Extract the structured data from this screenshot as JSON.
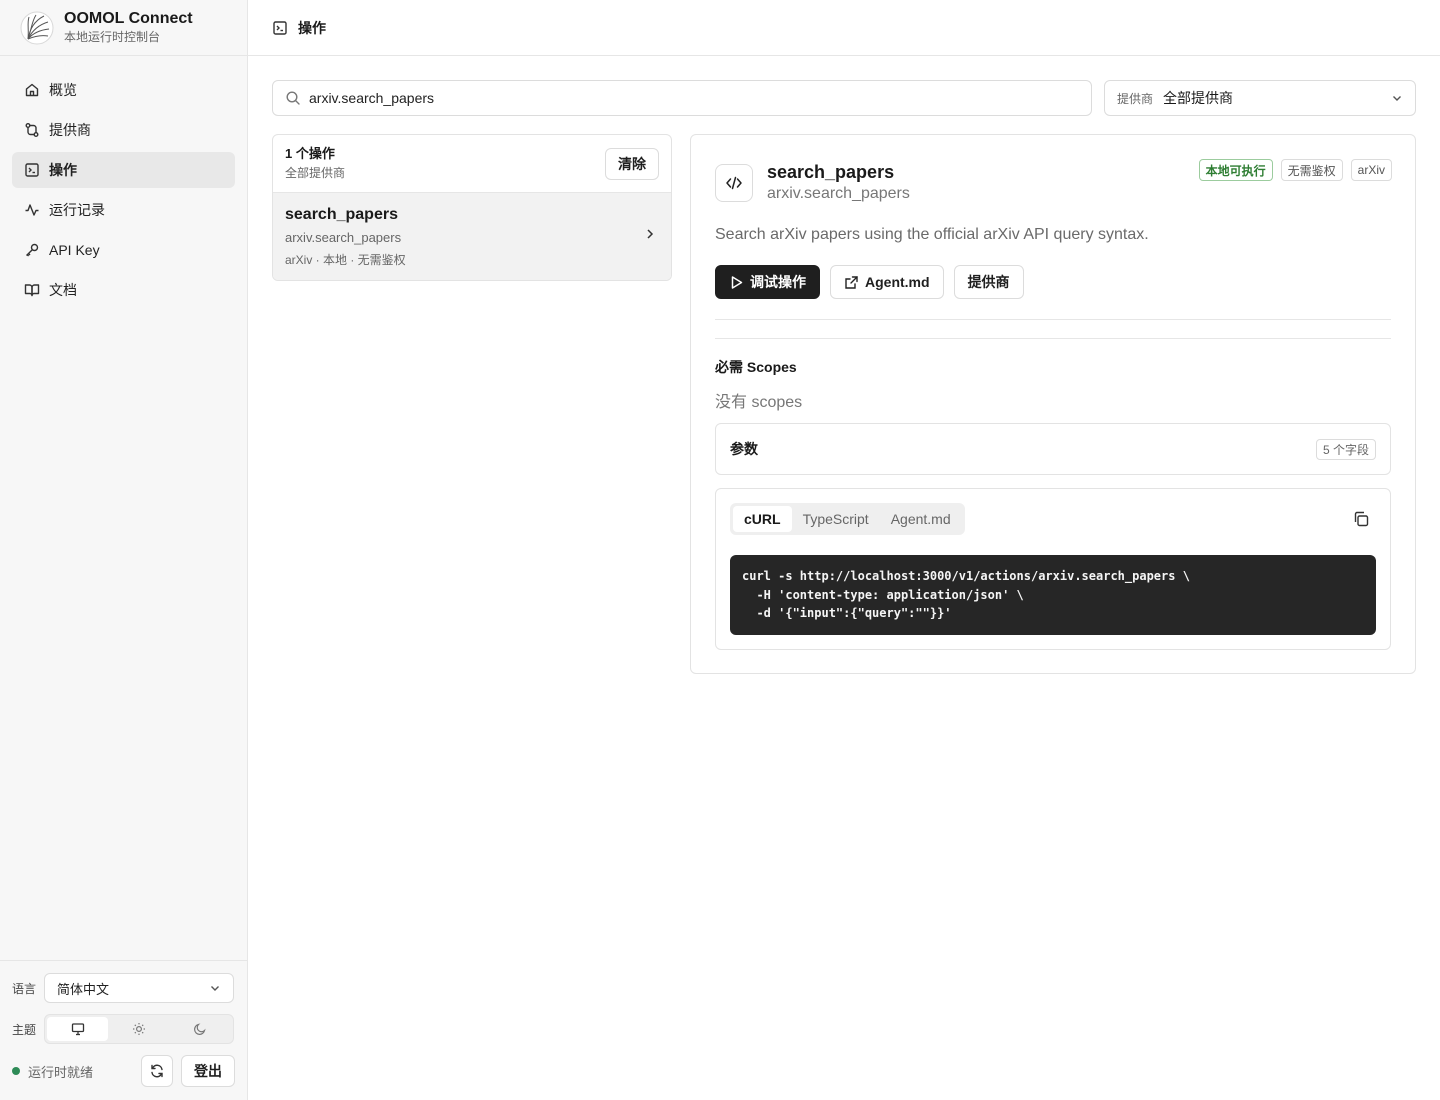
{
  "app": {
    "name": "OOMOL Connect",
    "subtitle": "本地运行时控制台"
  },
  "sidebar": {
    "items": [
      {
        "label": "概览",
        "icon": "home-icon",
        "active": false
      },
      {
        "label": "提供商",
        "icon": "route-icon",
        "active": false
      },
      {
        "label": "操作",
        "icon": "terminal-icon",
        "active": true
      },
      {
        "label": "运行记录",
        "icon": "activity-icon",
        "active": false
      },
      {
        "label": "API Key",
        "icon": "key-icon",
        "active": false
      },
      {
        "label": "文档",
        "icon": "book-icon",
        "active": false
      }
    ],
    "language_label": "语言",
    "language_value": "简体中文",
    "theme_label": "主题",
    "theme_options": [
      "system",
      "light",
      "dark"
    ],
    "theme_selected": "system",
    "status_text": "运行时就绪",
    "status_color": "#2e8b57",
    "logout_label": "登出"
  },
  "header": {
    "title": "操作"
  },
  "filters": {
    "search_value": "arxiv.search_papers",
    "provider_label": "提供商",
    "provider_value": "全部提供商"
  },
  "list": {
    "count_label": "1 个操作",
    "scope_label": "全部提供商",
    "clear_label": "清除",
    "items": [
      {
        "title": "search_papers",
        "id": "arxiv.search_papers",
        "meta": "arXiv · 本地 · 无需鉴权"
      }
    ]
  },
  "detail": {
    "title": "search_papers",
    "id": "arxiv.search_papers",
    "badges": [
      "本地可执行",
      "无需鉴权",
      "arXiv"
    ],
    "description": "Search arXiv papers using the official arXiv API query syntax.",
    "try_label": "调试操作",
    "agent_label": "Agent.md",
    "provider_label": "提供商",
    "scopes_title": "必需 Scopes",
    "scopes_empty": "没有 scopes",
    "params_title": "参数",
    "params_count": "5 个字段",
    "code_tabs": [
      "cURL",
      "TypeScript",
      "Agent.md"
    ],
    "code_tab_active": "cURL",
    "code_lines": [
      "curl -s http://localhost:3000/v1/actions/arxiv.search_papers \\",
      "  -H 'content-type: application/json' \\",
      "  -d '{\"input\":{\"query\":\"\"}}'"
    ]
  },
  "colors": {
    "accent": "#1f1f1f",
    "badge_green": "#2e7d32",
    "code_bg": "#262626"
  }
}
